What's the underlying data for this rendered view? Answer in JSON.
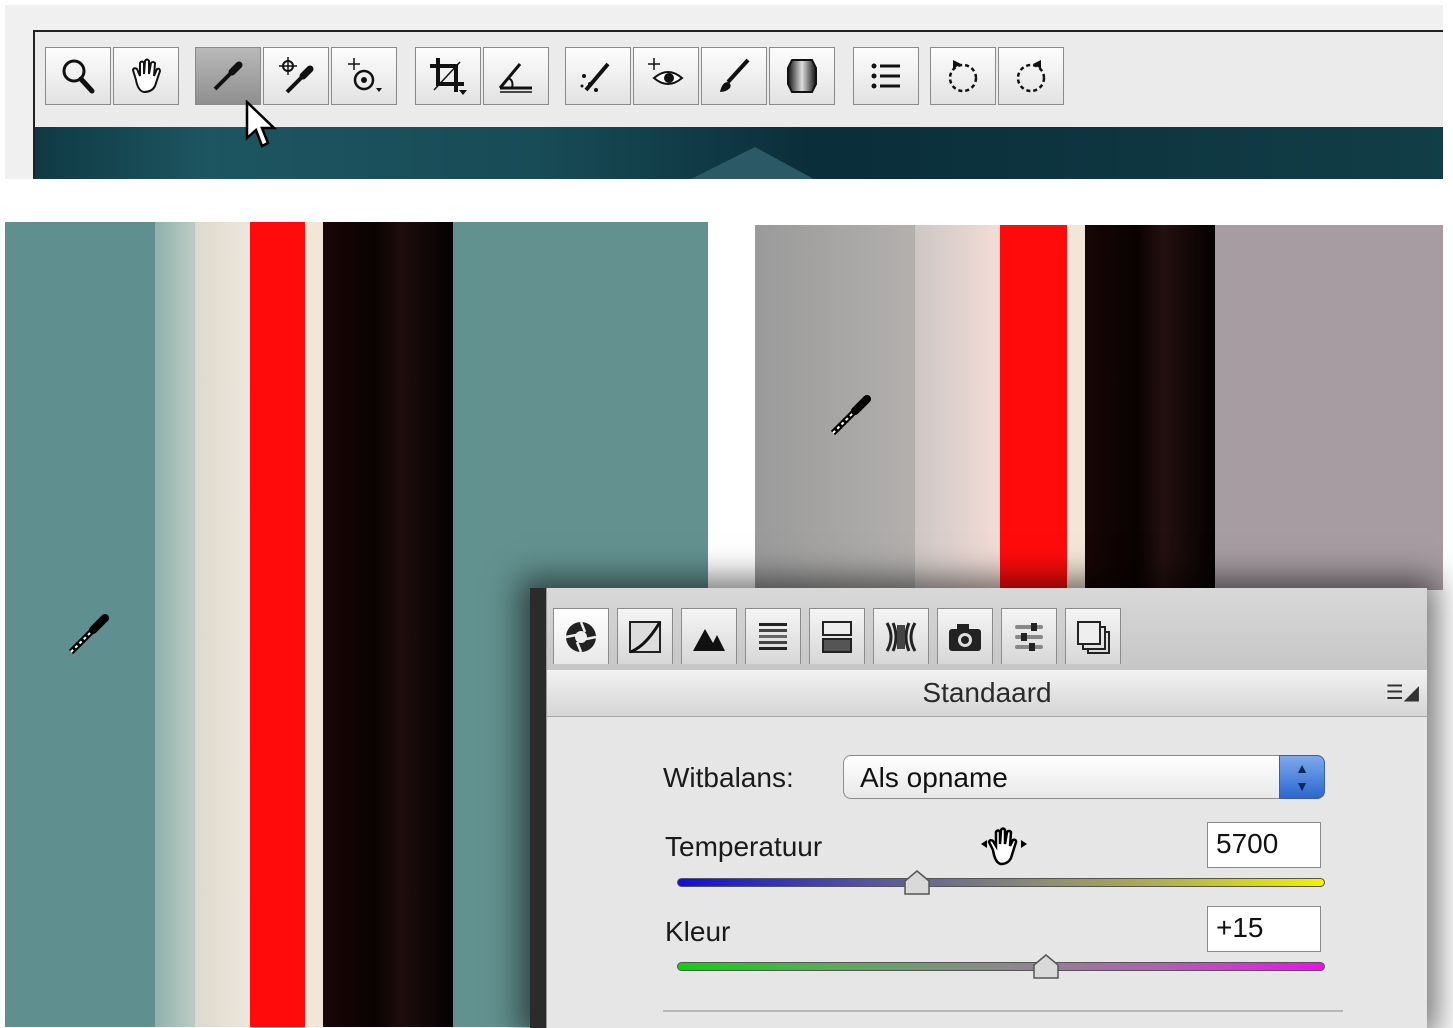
{
  "toolbar": {
    "icons": [
      "zoom-icon",
      "hand-icon",
      "white-balance-eyedropper-icon",
      "color-sampler-icon",
      "targeted-adjustment-icon",
      "crop-icon",
      "straighten-icon",
      "spot-removal-icon",
      "red-eye-removal-icon",
      "adjustment-brush-icon",
      "graduated-filter-icon",
      "preferences-icon",
      "rotate-left-icon",
      "rotate-right-icon"
    ],
    "active_tool": "white-balance-eyedropper-icon"
  },
  "views": {
    "before_background": "#5f8f8e",
    "after_background": "#a39aa0",
    "clipping_color": "#ff0000"
  },
  "panel": {
    "tabs": [
      "basic-tab",
      "tone-curve-tab",
      "detail-tab",
      "hsl-tab",
      "split-toning-tab",
      "lens-corrections-tab",
      "camera-calibration-tab",
      "presets-tab",
      "snapshots-tab"
    ],
    "header": {
      "title": "Standaard",
      "menu_glyph": "☰◢"
    },
    "white_balance": {
      "label": "Witbalans:",
      "value": "Als opname"
    },
    "temperature": {
      "label": "Temperatuur",
      "value": "5700",
      "slider_fraction": 0.37
    },
    "tint": {
      "label": "Kleur",
      "value": "+15",
      "slider_fraction": 0.57
    }
  }
}
